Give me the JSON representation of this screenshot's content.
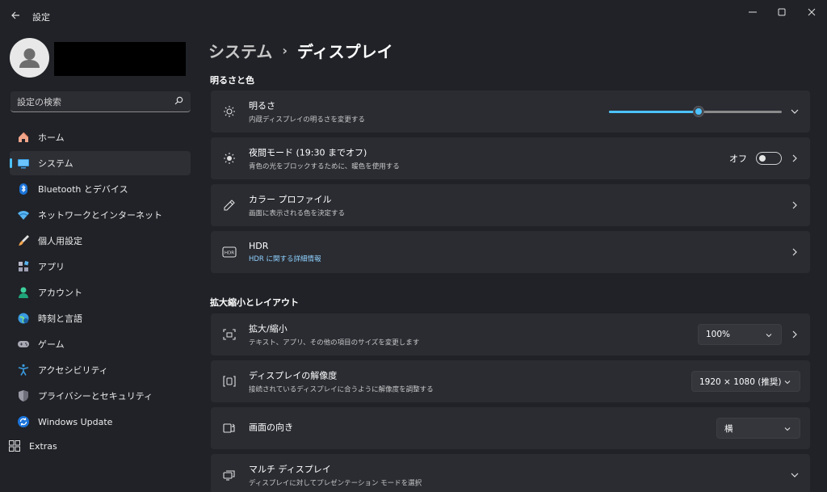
{
  "window": {
    "title": "設定"
  },
  "sidebar": {
    "search_placeholder": "設定の検索",
    "items": [
      {
        "label": "ホーム",
        "icon": "home-icon"
      },
      {
        "label": "システム",
        "icon": "system-icon",
        "active": true
      },
      {
        "label": "Bluetooth とデバイス",
        "icon": "bluetooth-icon"
      },
      {
        "label": "ネットワークとインターネット",
        "icon": "network-icon"
      },
      {
        "label": "個人用設定",
        "icon": "personalization-icon"
      },
      {
        "label": "アプリ",
        "icon": "apps-icon"
      },
      {
        "label": "アカウント",
        "icon": "account-icon"
      },
      {
        "label": "時刻と言語",
        "icon": "time-language-icon"
      },
      {
        "label": "ゲーム",
        "icon": "gaming-icon"
      },
      {
        "label": "アクセシビリティ",
        "icon": "accessibility-icon"
      },
      {
        "label": "プライバシーとセキュリティ",
        "icon": "privacy-shield-icon"
      },
      {
        "label": "Windows Update",
        "icon": "windows-update-icon"
      }
    ],
    "extras_label": "Extras"
  },
  "breadcrumb": {
    "parent": "システム",
    "separator": "›",
    "current": "ディスプレイ"
  },
  "sections": {
    "brightness_color": {
      "title": "明るさと色",
      "brightness": {
        "title": "明るさ",
        "subtitle": "内蔵ディスプレイの明るさを変更する",
        "value": 0.52
      },
      "night_light": {
        "title": "夜間モード (19:30 までオフ)",
        "subtitle": "青色の光をブロックするために、暖色を使用する",
        "state": "オフ"
      },
      "color_profile": {
        "title": "カラー プロファイル",
        "subtitle": "画面に表示される色を決定する"
      },
      "hdr": {
        "title": "HDR",
        "link": "HDR に関する詳細情報"
      }
    },
    "scale_layout": {
      "title": "拡大縮小とレイアウト",
      "scale": {
        "title": "拡大/縮小",
        "subtitle": "テキスト、アプリ、その他の項目のサイズを変更します",
        "value": "100%"
      },
      "resolution": {
        "title": "ディスプレイの解像度",
        "subtitle": "接続されているディスプレイに合うように解像度を調整する",
        "value": "1920 × 1080 (推奨)"
      },
      "orientation": {
        "title": "画面の向き",
        "value": "横"
      },
      "multi_display": {
        "title": "マルチ ディスプレイ",
        "subtitle": "ディスプレイに対してプレゼンテーション モードを選択"
      }
    }
  },
  "colors": {
    "accent": "#4cc2ff",
    "background": "#202227",
    "card": "#2a2c32"
  }
}
